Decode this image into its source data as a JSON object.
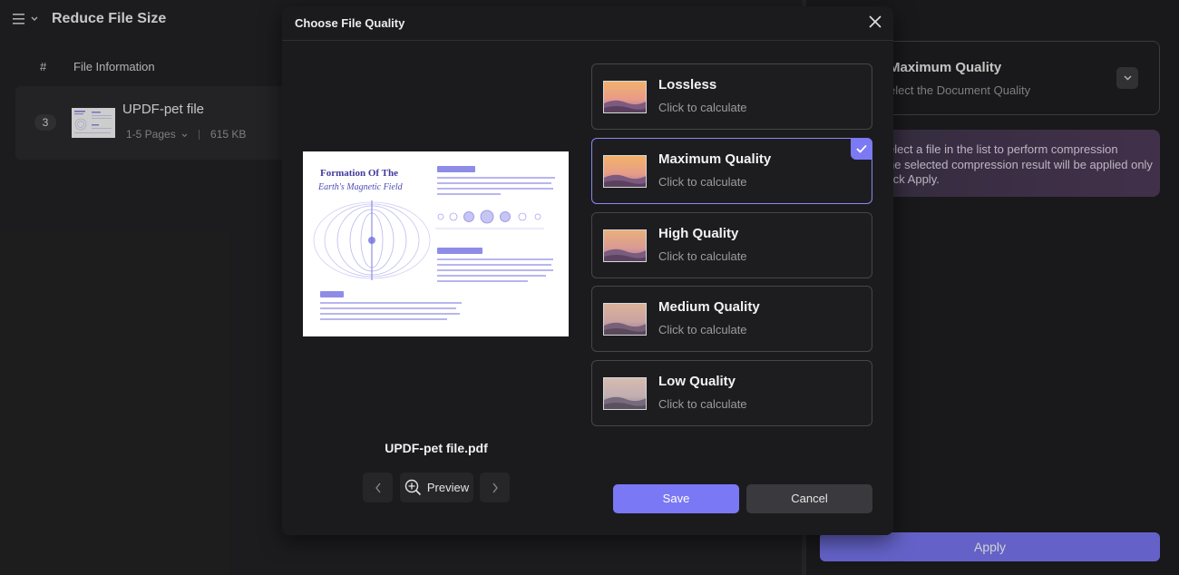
{
  "header": {
    "title": "Reduce File Size"
  },
  "icons": {
    "menu": "menu-icon",
    "close": "close-icon",
    "zoom": "zoom-in-icon",
    "prev": "chevron-left-icon",
    "next": "chevron-right-icon",
    "check": "check-icon",
    "dropdown": "chevron-down-icon"
  },
  "table": {
    "col_index": "#",
    "col_info": "File Information",
    "rows": [
      {
        "index": "3",
        "name": "UPDF-pet file",
        "pages": "1-5 Pages",
        "size": "615 KB"
      }
    ]
  },
  "right_panel": {
    "quality_title": "Maximum Quality",
    "quality_sub": "elect the Document Quality",
    "info_line1": "elect a file in the list to perform compression",
    "info_line2": "he selected compression result will be applied only",
    "info_line3": "lick Apply.",
    "apply_label": "Apply"
  },
  "modal": {
    "title": "Choose File Quality",
    "file_name": "UPDF-pet file.pdf",
    "preview_label": "Preview",
    "preview_doc": {
      "title_line1": "Formation Of The",
      "title_line2": "Earth's Magnetic Field"
    },
    "options": [
      {
        "title": "Lossless",
        "sub": "Click to calculate",
        "selected": false
      },
      {
        "title": "Maximum Quality",
        "sub": "Click to calculate",
        "selected": true
      },
      {
        "title": "High Quality",
        "sub": "Click to calculate",
        "selected": false
      },
      {
        "title": "Medium Quality",
        "sub": "Click to calculate",
        "selected": false
      },
      {
        "title": "Low Quality",
        "sub": "Click to calculate",
        "selected": false
      }
    ],
    "save_label": "Save",
    "cancel_label": "Cancel"
  },
  "colors": {
    "accent": "#7b78f5",
    "background": "#232325",
    "modal": "#1b1b1d"
  }
}
